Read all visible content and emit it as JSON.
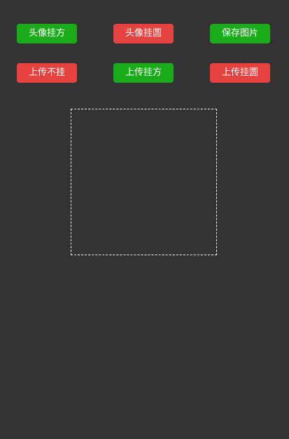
{
  "buttons": {
    "avatar_frame_square": "头像挂方",
    "avatar_frame_round": "头像挂圆",
    "save_image": "保存图片",
    "upload_no_frame": "上传不挂",
    "upload_frame_square": "上传挂方",
    "upload_frame_round": "上传挂圆"
  },
  "colors": {
    "background": "#333333",
    "green_button": "#1aad19",
    "red_button": "#e64340",
    "canvas_border": "#ffffff"
  }
}
